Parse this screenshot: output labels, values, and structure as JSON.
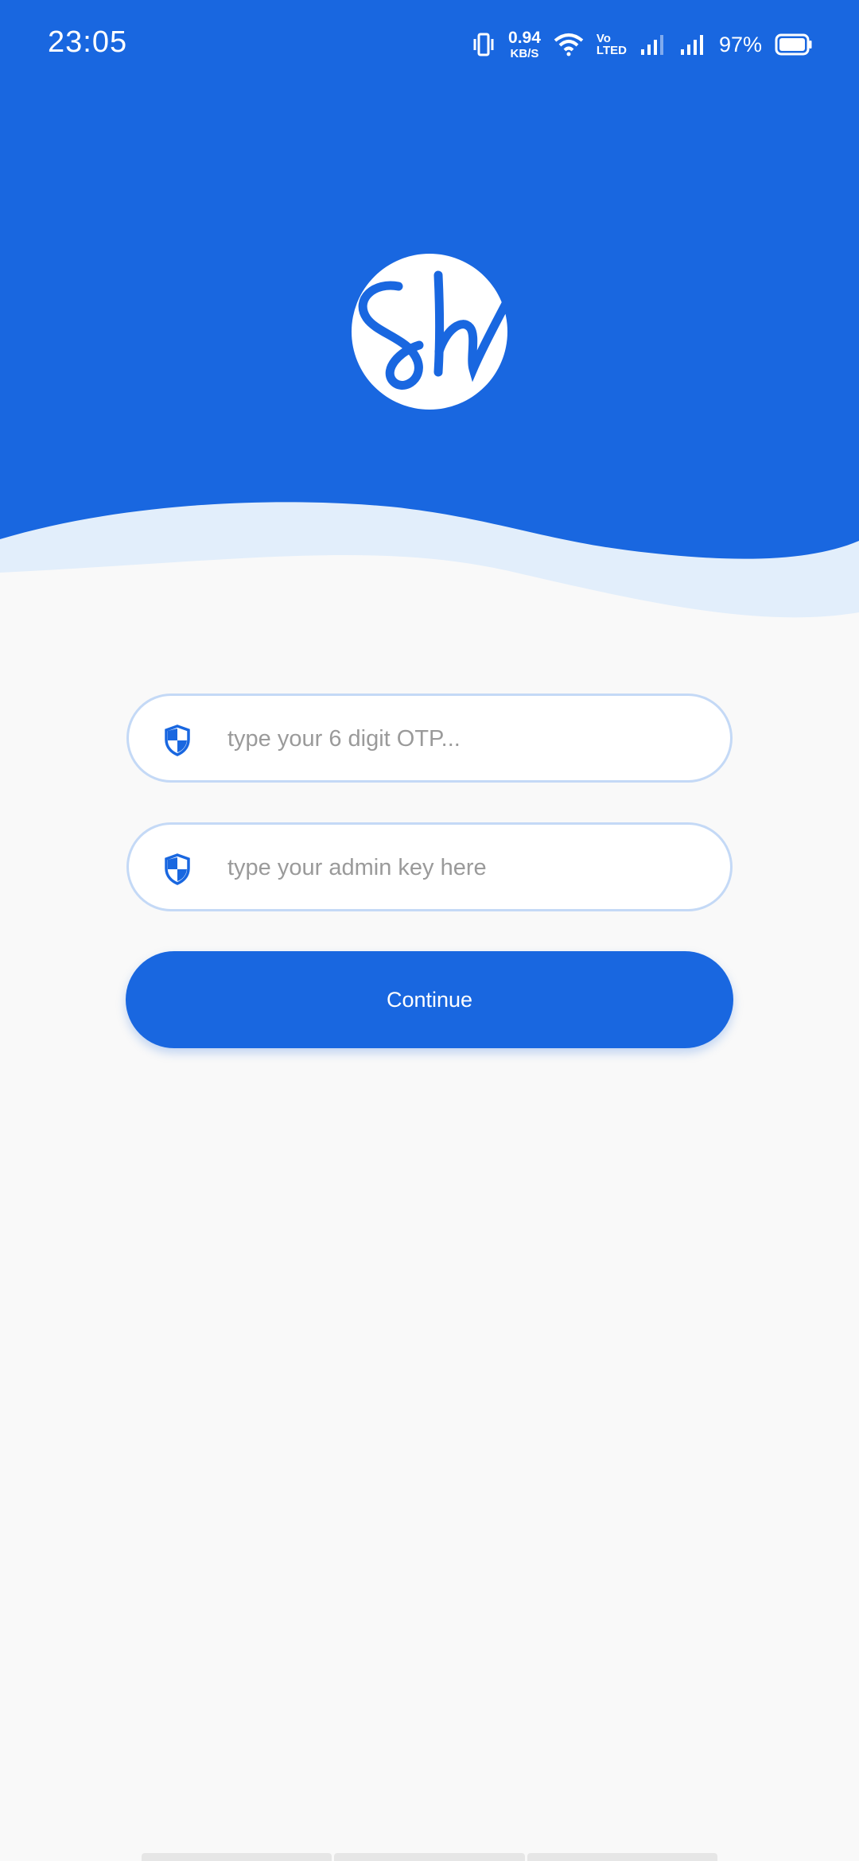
{
  "status_bar": {
    "time": "23:05",
    "net_speed_value": "0.94",
    "net_speed_unit": "KB/S",
    "volte_top": "Vo",
    "volte_bottom": "LTED",
    "battery_percent": "97%",
    "icons": [
      "vibrate-icon",
      "wifi-icon",
      "signal-icon",
      "signal-icon",
      "battery-icon"
    ]
  },
  "logo": {
    "monogram": "Sh"
  },
  "form": {
    "otp_placeholder": "type your 6 digit OTP...",
    "otp_value": "",
    "admin_key_placeholder": "type your admin key here",
    "admin_key_value": "",
    "continue_label": "Continue"
  },
  "colors": {
    "brand": "#1967e0",
    "wave_light": "#e2eefb",
    "background": "#f9f9f9",
    "field_border": "#c4d9f6"
  }
}
